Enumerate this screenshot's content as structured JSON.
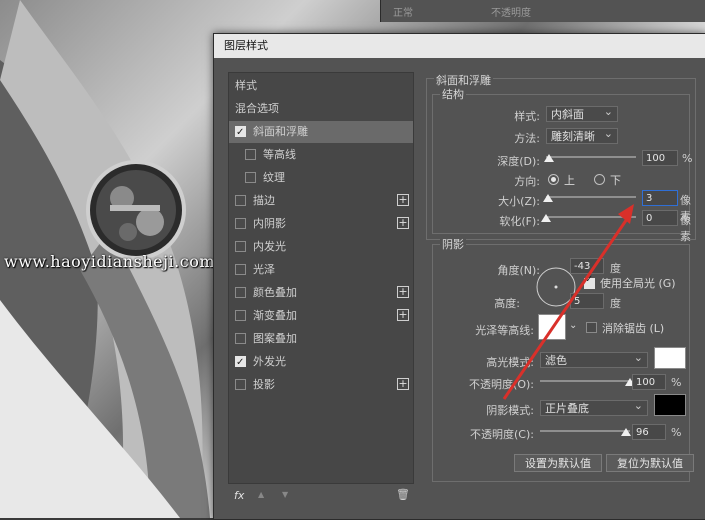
{
  "topbar": {
    "blend": "正常",
    "opacity": "不透明度"
  },
  "watermark": "www.haoyidiansheji.com",
  "dialog": {
    "title": "图层样式",
    "left_list": [
      {
        "label": "样式",
        "checkbox": false,
        "checked": false,
        "plus": false,
        "selected": false,
        "indent": 0
      },
      {
        "label": "混合选项",
        "checkbox": false,
        "checked": false,
        "plus": false,
        "selected": false,
        "indent": 0
      },
      {
        "label": "斜面和浮雕",
        "checkbox": true,
        "checked": true,
        "plus": false,
        "selected": true,
        "indent": 0
      },
      {
        "label": "等高线",
        "checkbox": true,
        "checked": false,
        "plus": false,
        "selected": false,
        "indent": 1
      },
      {
        "label": "纹理",
        "checkbox": true,
        "checked": false,
        "plus": false,
        "selected": false,
        "indent": 1
      },
      {
        "label": "描边",
        "checkbox": true,
        "checked": false,
        "plus": true,
        "selected": false,
        "indent": 0
      },
      {
        "label": "内阴影",
        "checkbox": true,
        "checked": false,
        "plus": true,
        "selected": false,
        "indent": 0
      },
      {
        "label": "内发光",
        "checkbox": true,
        "checked": false,
        "plus": false,
        "selected": false,
        "indent": 0
      },
      {
        "label": "光泽",
        "checkbox": true,
        "checked": false,
        "plus": false,
        "selected": false,
        "indent": 0
      },
      {
        "label": "颜色叠加",
        "checkbox": true,
        "checked": false,
        "plus": true,
        "selected": false,
        "indent": 0
      },
      {
        "label": "渐变叠加",
        "checkbox": true,
        "checked": false,
        "plus": true,
        "selected": false,
        "indent": 0
      },
      {
        "label": "图案叠加",
        "checkbox": true,
        "checked": false,
        "plus": false,
        "selected": false,
        "indent": 0
      },
      {
        "label": "外发光",
        "checkbox": true,
        "checked": true,
        "plus": false,
        "selected": false,
        "indent": 0
      },
      {
        "label": "投影",
        "checkbox": true,
        "checked": false,
        "plus": true,
        "selected": false,
        "indent": 0
      }
    ],
    "bottom_icons": {
      "fx": "fx",
      "up": "▲",
      "down": "▼",
      "trash": "🗑"
    },
    "bevel": {
      "section_title": "斜面和浮雕",
      "structure_title": "结构",
      "style_label": "样式:",
      "style_value": "内斜面",
      "method_label": "方法:",
      "method_value": "雕刻清晰",
      "depth_label": "深度(D):",
      "depth_value": "100",
      "depth_unit": "%",
      "depth_level": 0.03,
      "direction_label": "方向:",
      "dir_up": "上",
      "dir_down": "下",
      "size_label": "大小(Z):",
      "size_value": "3",
      "size_unit": "像素",
      "size_level": 0.02,
      "soften_label": "软化(F):",
      "soften_value": "0",
      "soften_unit": "像素",
      "soften_level": 0.0
    },
    "shading": {
      "title": "阴影",
      "angle_label": "角度(N):",
      "angle_value": "-43",
      "angle_unit": "度",
      "global_light_label": "使用全局光 (G)",
      "altitude_label": "高度:",
      "altitude_value": "5",
      "altitude_unit": "度",
      "gloss_label": "光泽等高线:",
      "antialias_label": "消除锯齿 (L)",
      "highlight_mode_label": "高光模式:",
      "highlight_mode_value": "滤色",
      "highlight_color": "#ffffff",
      "highlight_opacity_label": "不透明度(O):",
      "highlight_opacity_value": "100",
      "highlight_opacity_unit": "%",
      "highlight_level": 1.0,
      "shadow_mode_label": "阴影模式:",
      "shadow_mode_value": "正片叠底",
      "shadow_color": "#000000",
      "shadow_opacity_label": "不透明度(C):",
      "shadow_opacity_value": "96",
      "shadow_opacity_unit": "%",
      "shadow_level": 0.96
    },
    "buttons": {
      "make_default": "设置为默认值",
      "reset_default": "复位为默认值"
    }
  },
  "colors": {
    "arrow": "#d9302a",
    "input_focus": "#2f6fd6"
  }
}
